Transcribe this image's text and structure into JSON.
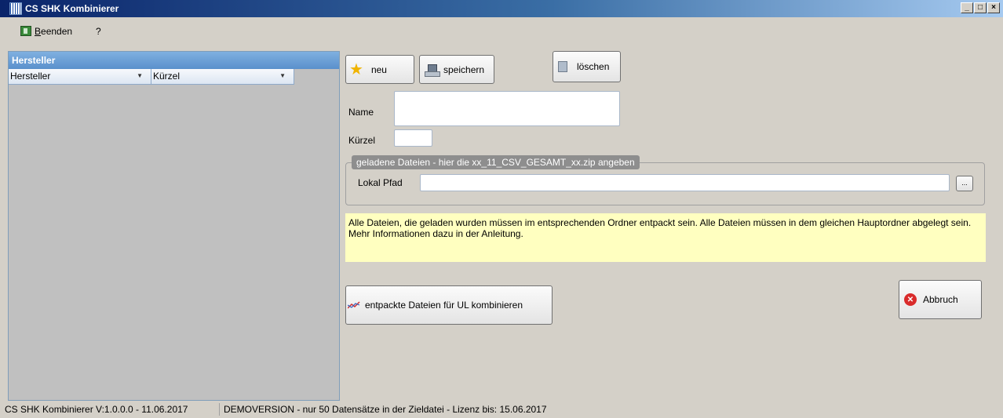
{
  "window": {
    "title": "CS SHK Kombinierer",
    "controls": [
      "_",
      "□",
      "×"
    ]
  },
  "menu": {
    "exit_label_underlined": "B",
    "exit_label_rest": "eenden",
    "help_label": "?"
  },
  "left_panel": {
    "header": "Hersteller",
    "columns": [
      "Hersteller",
      "Kürzel"
    ]
  },
  "toolbar": {
    "new_label": "neu",
    "save_label": "speichern",
    "delete_label": "löschen"
  },
  "form": {
    "name_label": "Name",
    "name_value": "",
    "short_label": "Kürzel",
    "short_value": ""
  },
  "files_group": {
    "title": "geladene Dateien - hier die xx_11_CSV_GESAMT_xx.zip angeben",
    "path_label": "Lokal Pfad",
    "path_value": "",
    "browse_label": "..."
  },
  "info_text": "Alle Dateien, die geladen wurden müssen im entsprechenden Ordner entpackt sein. Alle Dateien müssen in dem gleichen Hauptordner abgelegt sein. Mehr Informationen dazu in der Anleitung.",
  "actions": {
    "combine_label": "entpackte Dateien für UL kombinieren",
    "cancel_label": "Abbruch"
  },
  "status": {
    "version": "CS SHK Kombinierer V:1.0.0.0 - 11.06.2017",
    "license": "DEMOVERSION - nur 50 Datensätze in der Zieldatei - Lizenz bis: 15.06.2017"
  },
  "colors": {
    "title_gradient_start": "#0a246a",
    "left_header": "#6a9fd6",
    "info_background": "#ffffc0",
    "cancel_icon": "#d92b2b"
  }
}
